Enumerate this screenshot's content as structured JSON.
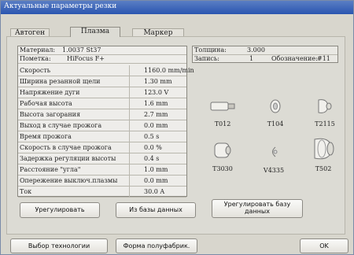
{
  "window": {
    "title": "Актуальные параметры резки"
  },
  "tabs": [
    {
      "label": "Автоген"
    },
    {
      "label": "Плазма"
    },
    {
      "label": "Маркер"
    }
  ],
  "header": {
    "material_label": "Материал:",
    "material_value": "1.0037 St37",
    "note_label": "Пометка:",
    "note_value": "HiFocus F+",
    "thickness_label": "Толщина:",
    "thickness_value": "3.000",
    "record_label": "Запись:",
    "record_value": "1",
    "designation_label": "Обозначение:",
    "designation_value": "#11"
  },
  "params": [
    {
      "label": "Скорость",
      "value": "1160.0 mm/min"
    },
    {
      "label": "Ширина резанной щели",
      "value": "1.30 mm"
    },
    {
      "label": "Напряжение дуги",
      "value": "123.0 V"
    },
    {
      "label": "Рабочая высота",
      "value": "1.6 mm"
    },
    {
      "label": "Высота загорания",
      "value": "2.7 mm"
    },
    {
      "label": "Выход в случае прожога",
      "value": "0.0 mm"
    },
    {
      "label": "Время прожога",
      "value": "0.5 s"
    },
    {
      "label": "Скорость в случае прожога",
      "value": "0.0 %"
    },
    {
      "label": "Задержка регуляции высоты",
      "value": "0.4 s"
    },
    {
      "label": "Расстояние \"угла\"",
      "value": "1.0 mm"
    },
    {
      "label": "Опережение выключ.плазмы",
      "value": "0.0 mm"
    },
    {
      "label": "Ток",
      "value": "30.0 A"
    }
  ],
  "consumables": [
    {
      "label": "T012"
    },
    {
      "label": "T104"
    },
    {
      "label": "T2115"
    },
    {
      "label": "T3030"
    },
    {
      "label": "V4335"
    },
    {
      "label": "T502"
    }
  ],
  "buttons": {
    "adjust": "Урегулировать",
    "from_db": "Из базы данных",
    "adjust_db_line1": "Урегулировать базу",
    "adjust_db_line2": "данных",
    "tech_select": "Выбор технологии",
    "blank_form": "Форма полуфабрик.",
    "ok": "OK"
  }
}
